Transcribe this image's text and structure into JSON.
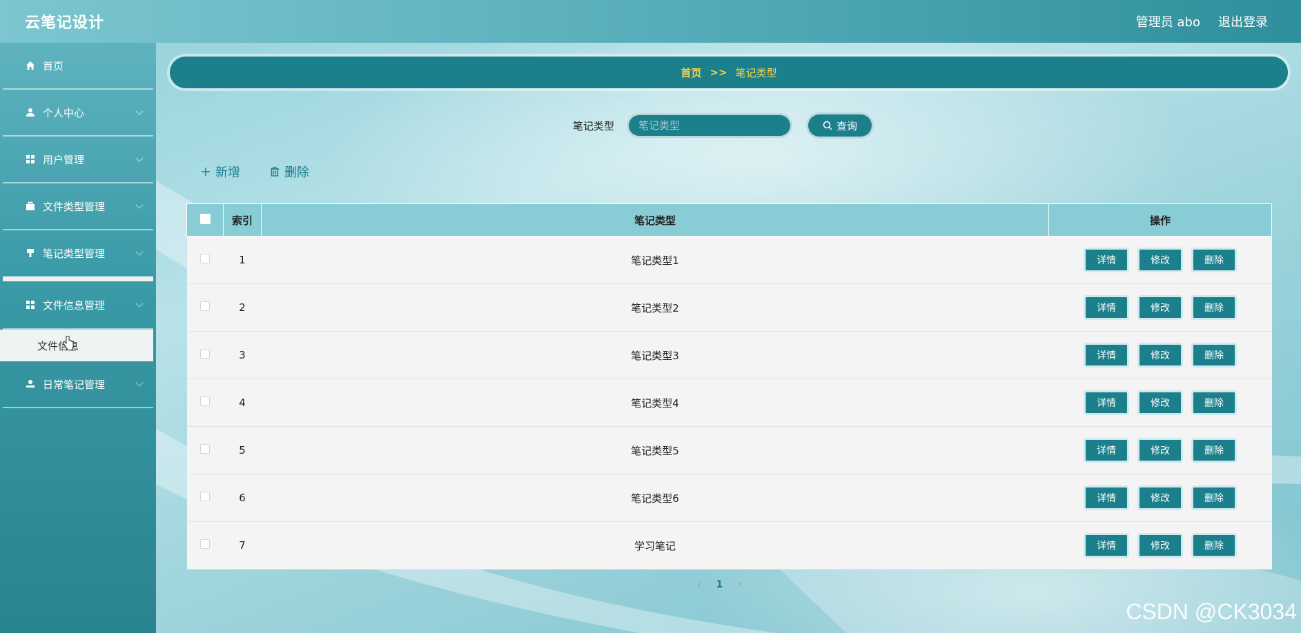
{
  "header": {
    "app_title": "云笔记设计",
    "admin_label": "管理员 abo",
    "logout_label": "退出登录"
  },
  "sidebar": {
    "items": [
      {
        "label": "首页",
        "icon": "home-icon"
      },
      {
        "label": "个人中心",
        "icon": "user-icon"
      },
      {
        "label": "用户管理",
        "icon": "grid-icon"
      },
      {
        "label": "文件类型管理",
        "icon": "briefcase-icon"
      },
      {
        "label": "笔记类型管理",
        "icon": "pin-icon"
      },
      {
        "label": "文件信息管理",
        "icon": "grid-icon"
      },
      {
        "label": "日常笔记管理",
        "icon": "user-icon"
      }
    ],
    "submenu_item": "文件信息"
  },
  "breadcrumb": {
    "home": "首页",
    "separator": ">>",
    "current": "笔记类型"
  },
  "search": {
    "label": "笔记类型",
    "placeholder": "笔记类型",
    "button_label": "查询"
  },
  "actions": {
    "add_label": "新增",
    "delete_label": "删除"
  },
  "table": {
    "headers": [
      "索引",
      "笔记类型",
      "操作"
    ],
    "rows": [
      {
        "index": "1",
        "type": "笔记类型1"
      },
      {
        "index": "2",
        "type": "笔记类型2"
      },
      {
        "index": "3",
        "type": "笔记类型3"
      },
      {
        "index": "4",
        "type": "笔记类型4"
      },
      {
        "index": "5",
        "type": "笔记类型5"
      },
      {
        "index": "6",
        "type": "笔记类型6"
      },
      {
        "index": "7",
        "type": "学习笔记"
      }
    ],
    "op_labels": {
      "detail": "详情",
      "edit": "修改",
      "delete": "删除"
    }
  },
  "pagination": {
    "current_page": "1"
  },
  "watermark": "CSDN @CK3034",
  "colors": {
    "primary": "#1c7f8c",
    "breadcrumb_text": "#f4d34a",
    "header_row": "#88ccd6"
  }
}
